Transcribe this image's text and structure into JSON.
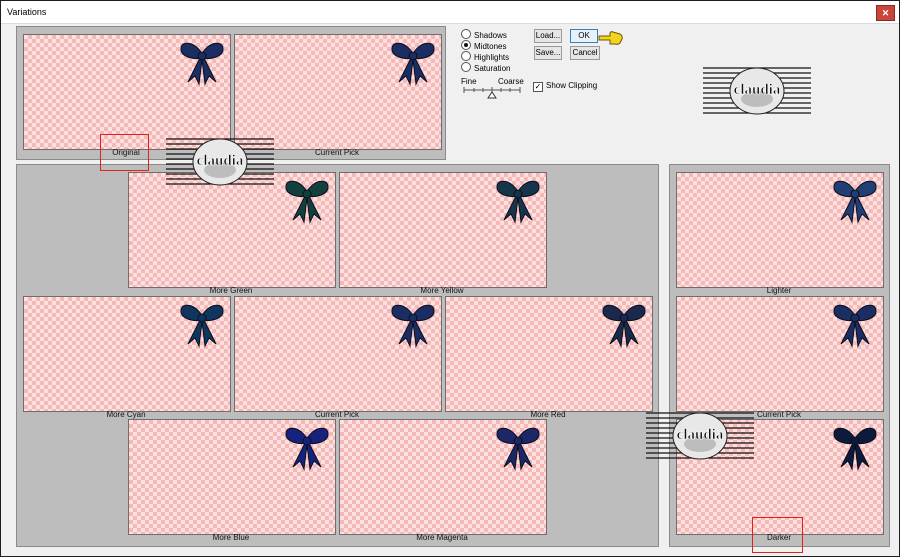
{
  "window": {
    "title": "Variations",
    "close_glyph": "✕"
  },
  "top_previews": {
    "original": "Original",
    "current_pick": "Current Pick"
  },
  "range": {
    "options": [
      "Shadows",
      "Midtones",
      "Highlights",
      "Saturation"
    ],
    "selected": "Midtones"
  },
  "buttons": {
    "load": "Load...",
    "ok": "OK",
    "save": "Save...",
    "cancel": "Cancel"
  },
  "fine_coarse": {
    "fine": "Fine",
    "coarse": "Coarse"
  },
  "show_clipping": {
    "label": "Show Clipping",
    "checked": true
  },
  "watermark": {
    "text": "claudia"
  },
  "color_grid": {
    "more_green": "More Green",
    "more_yellow": "More Yellow",
    "more_cyan": "More Cyan",
    "current_pick": "Current Pick",
    "more_red": "More Red",
    "more_blue": "More Blue",
    "more_magenta": "More Magenta"
  },
  "lightness": {
    "lighter": "Lighter",
    "current_pick": "Current Pick",
    "darker": "Darker"
  },
  "bow_colors": {
    "original": "#1b2e63",
    "green": "#12403d",
    "yellow": "#16354a",
    "cyan": "#10355e",
    "red": "#1b2a4c",
    "blue": "#16237e",
    "magenta": "#1d2765",
    "lighter": "#213f75",
    "darker": "#0e1a3c"
  }
}
